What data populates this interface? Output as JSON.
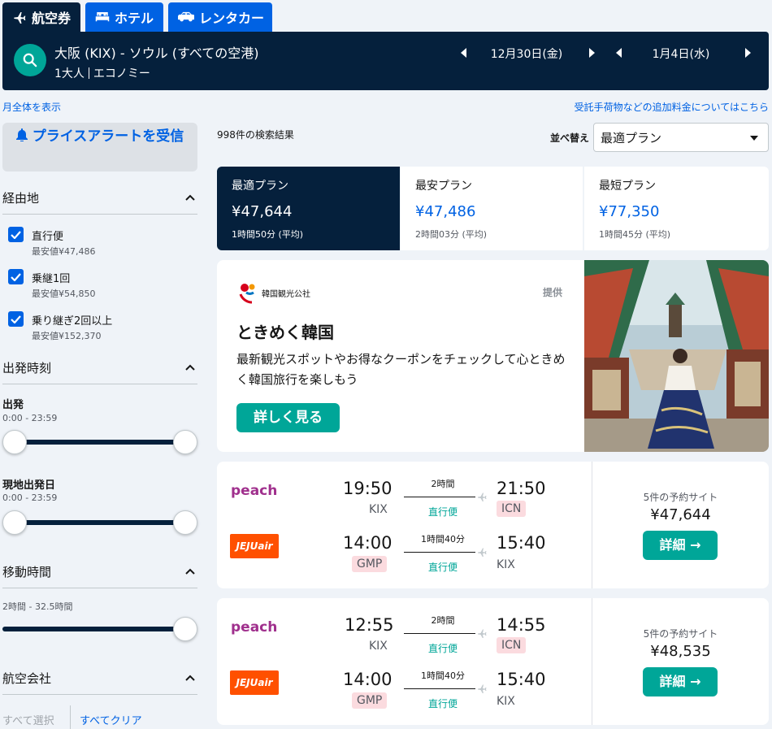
{
  "tabs": [
    {
      "label": "航空券",
      "icon": "plane-icon",
      "active": true
    },
    {
      "label": "ホテル",
      "icon": "bed-icon",
      "active": false
    },
    {
      "label": "レンタカー",
      "icon": "car-icon",
      "active": false
    }
  ],
  "search": {
    "route": "大阪 (KIX) - ソウル (すべての空港)",
    "passengers": "1大人",
    "cabin": "エコノミー",
    "depart_date": "12月30日(金)",
    "return_date": "1月4日(水)"
  },
  "links": {
    "show_month": "月全体を表示",
    "baggage_fees": "受託手荷物などの追加料金についてはこちら"
  },
  "sidebar": {
    "price_alert": "プライスアラートを受信",
    "stops": {
      "title": "経由地",
      "items": [
        {
          "label": "直行便",
          "sub": "最安値¥47,486",
          "checked": true
        },
        {
          "label": "乗継1回",
          "sub": "最安値¥54,850",
          "checked": true
        },
        {
          "label": "乗り継ぎ2回以上",
          "sub": "最安値¥152,370",
          "checked": true
        }
      ]
    },
    "times": {
      "title": "出発時刻",
      "outbound_label": "出発",
      "outbound_range": "0:00 - 23:59",
      "return_label": "現地出発日",
      "return_range": "0:00 - 23:59"
    },
    "duration": {
      "title": "移動時間",
      "range": "2時間 - 32.5時間"
    },
    "airlines": {
      "title": "航空会社",
      "select_all": "すべて選択",
      "clear_all": "すべてクリア"
    }
  },
  "results": {
    "count": "998件の検索結果",
    "sort_label": "並べ替え",
    "sort_value": "最適プラン",
    "sort_tabs": [
      {
        "label": "最適プラン",
        "price": "¥47,644",
        "duration": "1時間50分 (平均)",
        "active": true
      },
      {
        "label": "最安プラン",
        "price": "¥47,486",
        "duration": "2時間03分 (平均)",
        "active": false
      },
      {
        "label": "最短プラン",
        "price": "¥77,350",
        "duration": "1時間45分 (平均)",
        "active": false
      }
    ]
  },
  "ad": {
    "logo_text": "韓国観光公社",
    "sponsor": "提供",
    "title": "ときめく韓国",
    "description": "最新観光スポットやお得なクーポンをチェックして心ときめく韓国旅行を楽しもう",
    "cta": "詳しく見る"
  },
  "flights": [
    {
      "legs": [
        {
          "airline": "peach",
          "dep_time": "19:50",
          "dep_code": "KIX",
          "dep_warn": false,
          "duration": "2時間",
          "stops": "直行便",
          "arr_time": "21:50",
          "arr_code": "ICN",
          "arr_warn": true
        },
        {
          "airline": "JEJUair",
          "dep_time": "14:00",
          "dep_code": "GMP",
          "dep_warn": true,
          "duration": "1時間40分",
          "stops": "直行便",
          "arr_time": "15:40",
          "arr_code": "KIX",
          "arr_warn": false
        }
      ],
      "sites": "5件の予約サイト",
      "price": "¥47,644",
      "cta": "詳細 →"
    },
    {
      "legs": [
        {
          "airline": "peach",
          "dep_time": "12:55",
          "dep_code": "KIX",
          "dep_warn": false,
          "duration": "2時間",
          "stops": "直行便",
          "arr_time": "14:55",
          "arr_code": "ICN",
          "arr_warn": true
        },
        {
          "airline": "JEJUair",
          "dep_time": "14:00",
          "dep_code": "GMP",
          "dep_warn": true,
          "duration": "1時間40分",
          "stops": "直行便",
          "arr_time": "15:40",
          "arr_code": "KIX",
          "arr_warn": false
        }
      ],
      "sites": "5件の予約サイト",
      "price": "¥48,535",
      "cta": "詳細 →"
    }
  ],
  "colors": {
    "navy": "#05203c",
    "blue": "#0062e3",
    "teal": "#00a698"
  }
}
